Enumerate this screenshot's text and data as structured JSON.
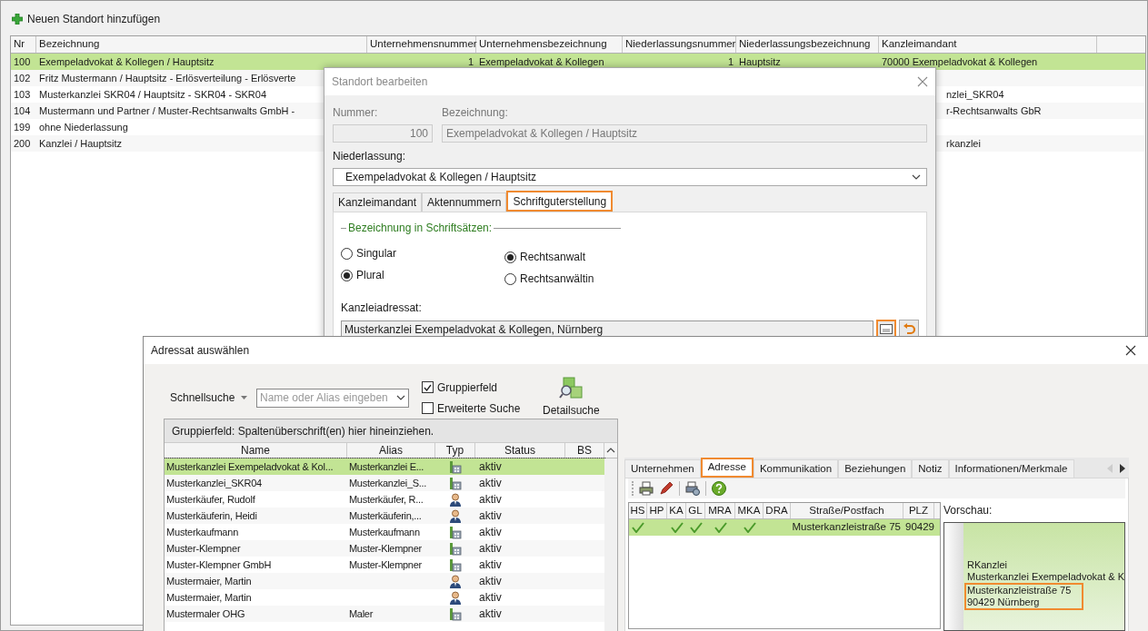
{
  "toolbar": {
    "add_button": "Neuen Standort hinzufügen"
  },
  "locations_table": {
    "columns": [
      "Nr",
      "Bezeichnung",
      "Unternehmensnummer",
      "Unternehmensbezeichnung",
      "Niederlassungsnummer",
      "Niederlassungsbezeichnung",
      "Kanzleimandant"
    ],
    "rows": [
      {
        "selected": true,
        "cells": [
          "100",
          "Exempeladvokat & Kollegen / Hauptsitz",
          "1",
          "Exempeladvokat & Kollegen",
          "1",
          "Hauptsitz",
          "70000 Exempeladvokat & Kollegen"
        ]
      },
      {
        "selected": false,
        "cells": [
          "102",
          "Fritz Mustermann / Hauptsitz - Erlösverteilung - Erlösverte"
        ]
      },
      {
        "selected": false,
        "cells": [
          "103",
          "Musterkanzlei SKR04 / Hauptsitz - SKR04 - SKR04"
        ],
        "kanzleimandant": "nzlei_SKR04"
      },
      {
        "selected": false,
        "cells": [
          "104",
          "Mustermann und Partner / Muster-Rechtsanwalts GmbH -"
        ],
        "kanzleimandant": "r-Rechtsanwalts GbR"
      },
      {
        "selected": false,
        "cells": [
          "199",
          "ohne Niederlassung"
        ]
      },
      {
        "selected": false,
        "cells": [
          "200",
          "Kanzlei / Hauptsitz"
        ],
        "kanzleimandant": "rkanzlei"
      }
    ]
  },
  "standort_dialog": {
    "title": "Standort bearbeiten",
    "nummer_label": "Nummer:",
    "nummer": "100",
    "bezeichnung_label": "Bezeichnung:",
    "bezeichnung": "Exempeladvokat & Kollegen / Hauptsitz",
    "niederlassung_label": "Niederlassung:",
    "niederlassung": "Exempeladvokat & Kollegen / Hauptsitz",
    "tabs": [
      {
        "label": "Kanzleimandant",
        "selected": false,
        "highlighted": false
      },
      {
        "label": "Aktennummern",
        "selected": false,
        "highlighted": false
      },
      {
        "label": "Schriftguterstellung",
        "selected": true,
        "highlighted": true
      }
    ],
    "group_title": "Bezeichnung in Schriftsätzen:",
    "number_options": [
      {
        "label": "Singular",
        "selected": false
      },
      {
        "label": "Plural",
        "selected": true
      }
    ],
    "title_options": [
      {
        "label": "Rechtsanwalt",
        "selected": true
      },
      {
        "label": "Rechtsanwältin",
        "selected": false
      }
    ],
    "kanzleiadressat_label": "Kanzleiadressat:",
    "kanzleiadressat": "Musterkanzlei Exempeladvokat & Kollegen, Nürnberg",
    "select_button": {
      "highlighted": true
    }
  },
  "adressat_dialog": {
    "title": "Adressat auswählen",
    "quick_search_label": "Schnellsuche",
    "search_placeholder": "Name oder Alias eingeben",
    "options": [
      {
        "label": "Gruppierfeld",
        "checked": true
      },
      {
        "label": "Erweiterte Suche",
        "checked": false
      }
    ],
    "detail_search": "Detailsuche",
    "group_hint": "Gruppierfeld: Spaltenüberschrift(en) hier hineinziehen.",
    "columns": [
      "Name",
      "Alias",
      "Typ",
      "Status",
      "BS"
    ],
    "rows": [
      {
        "name": "Musterkanzlei Exempeladvokat & Kol...",
        "alias": "Musterkanzlei E...",
        "kind": "company",
        "status": "aktiv",
        "selected": true
      },
      {
        "name": "Musterkanzlei_SKR04",
        "alias": "Musterkanzlei_S...",
        "kind": "company",
        "status": "aktiv",
        "selected": false
      },
      {
        "name": "Musterkäufer, Rudolf",
        "alias": "Musterkäufer, R...",
        "kind": "person",
        "status": "aktiv",
        "selected": false
      },
      {
        "name": "Musterkäuferin, Heidi",
        "alias": "Musterkäuferin,...",
        "kind": "person",
        "status": "aktiv",
        "selected": false
      },
      {
        "name": "Musterkaufmann",
        "alias": "Musterkaufmann",
        "kind": "company",
        "status": "aktiv",
        "selected": false
      },
      {
        "name": "Muster-Klempner",
        "alias": "Muster-Klempner",
        "kind": "company",
        "status": "aktiv",
        "selected": false
      },
      {
        "name": "Muster-Klempner GmbH",
        "alias": "Muster-Klempner",
        "kind": "company",
        "status": "aktiv",
        "selected": false
      },
      {
        "name": "Mustermaier, Martin",
        "kind": "person",
        "status": "aktiv",
        "selected": false
      },
      {
        "name": "Mustermaier, Martin",
        "kind": "person",
        "status": "aktiv",
        "selected": false
      },
      {
        "name": "Mustermaler OHG",
        "alias": "Maler",
        "kind": "company",
        "status": "aktiv",
        "selected": false
      }
    ],
    "detail_tabs": [
      {
        "label": "Unternehmen",
        "selected": false,
        "highlighted": false
      },
      {
        "label": "Adresse",
        "selected": true,
        "highlighted": true
      },
      {
        "label": "Kommunikation",
        "selected": false,
        "highlighted": false
      },
      {
        "label": "Beziehungen",
        "selected": false,
        "highlighted": false
      },
      {
        "label": "Notiz",
        "selected": false,
        "highlighted": false
      },
      {
        "label": "Informationen/Merkmale",
        "selected": false,
        "highlighted": false
      }
    ],
    "address_grid": {
      "check_columns": [
        "HS",
        "HP",
        "KA",
        "GL",
        "MRA",
        "MKA",
        "DRA"
      ],
      "columns": [
        "Straße/Postfach",
        "PLZ"
      ],
      "rows": [
        {
          "checks": [
            true,
            false,
            true,
            true,
            true,
            true,
            false
          ],
          "street": "Musterkanzleistraße 75",
          "plz": "90429",
          "selected": true
        }
      ]
    },
    "preview_label": "Vorschau:",
    "preview_lines": [
      {
        "text": "RKanzlei",
        "highlighted": false
      },
      {
        "text": "Musterkanzlei Exempeladvokat & K",
        "highlighted": false
      },
      {
        "text": "Musterkanzleistraße 75",
        "highlighted": true
      },
      {
        "text": "90429 Nürnberg",
        "highlighted": true
      }
    ]
  }
}
